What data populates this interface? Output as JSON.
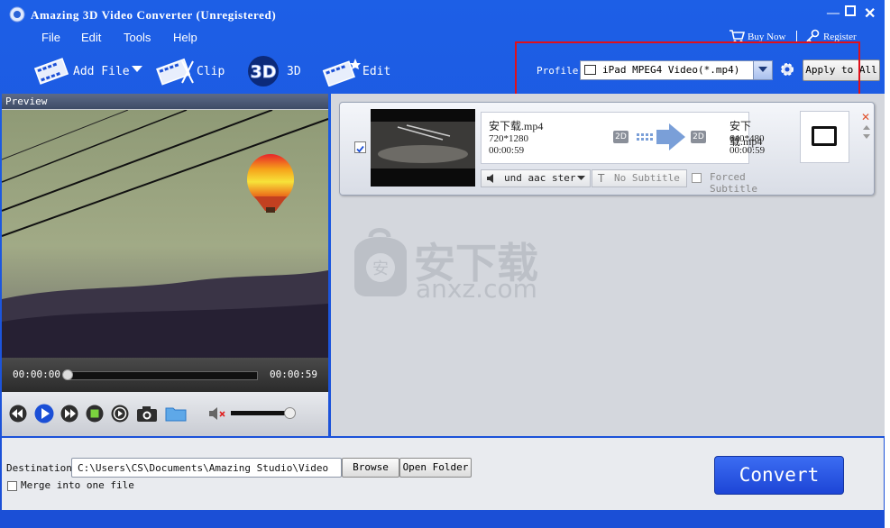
{
  "window": {
    "title": "Amazing 3D Video Converter (Unregistered)"
  },
  "menu": [
    "File",
    "Edit",
    "Tools",
    "Help"
  ],
  "toplinks": {
    "buy_now": "Buy Now",
    "register": "Register"
  },
  "toolbar": {
    "add_file": "Add File",
    "clip": "Clip",
    "three_d": "3D",
    "edit": "Edit"
  },
  "profile": {
    "label": "Profile:",
    "value": "iPad MPEG4 Video(*.mp4)",
    "apply_all": "Apply to All"
  },
  "preview": {
    "header": "Preview",
    "time_start": "00:00:00",
    "time_end": "00:00:59",
    "progress": 0.0,
    "volume": 0.95
  },
  "file": {
    "checked": true,
    "source_name": "安下载.mp4",
    "source_res": "720*1280",
    "source_duration": "00:00:59",
    "source_badge": "2D",
    "target_badge": "2D",
    "target_name": "安下载.mp4",
    "target_res": "640*480",
    "target_duration": "00:00:59",
    "audio": "und aac ster",
    "subtitle": "No Subtitle",
    "forced_subtitle": "Forced Subtitle"
  },
  "watermark": {
    "text_cn": "安下载",
    "text_en": "anxz.com"
  },
  "bottom": {
    "destination_label": "Destination:",
    "destination_path": "C:\\Users\\CS\\Documents\\Amazing Studio\\Video",
    "browse": "Browse",
    "open_folder": "Open Folder",
    "merge_label": "Merge into one file",
    "merge_checked": false,
    "convert": "Convert"
  },
  "colors": {
    "accent": "#1b4fd6",
    "highlight_box": "#e0101a"
  }
}
